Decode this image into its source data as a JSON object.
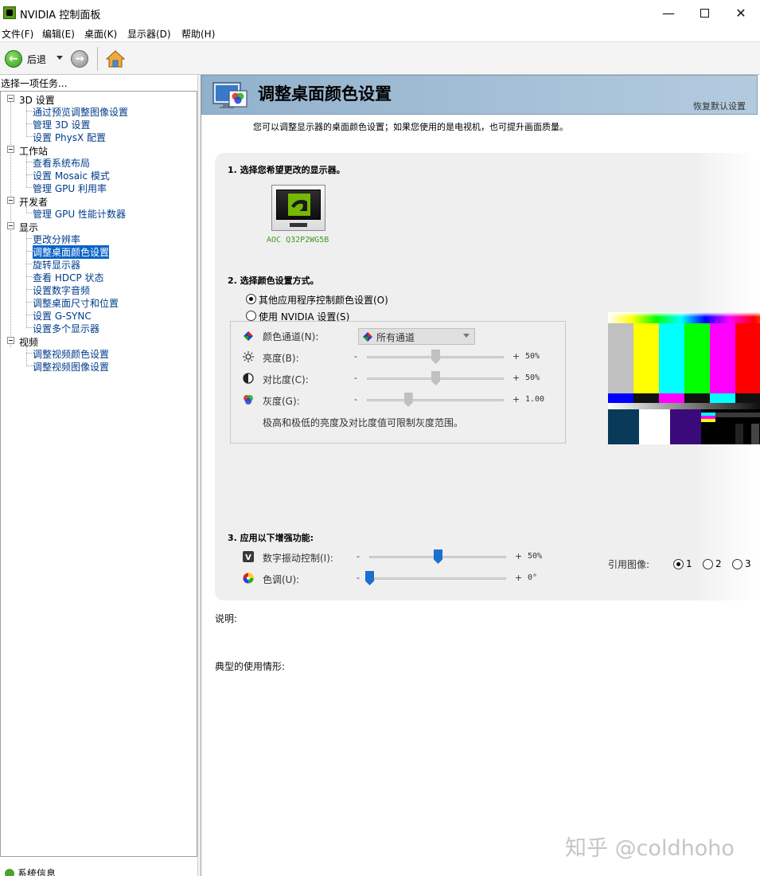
{
  "window": {
    "title": "NVIDIA 控制面板"
  },
  "menu": [
    "文件(F)",
    "编辑(E)",
    "桌面(K)",
    "显示器(D)",
    "帮助(H)"
  ],
  "toolbar": {
    "back_label": "后退"
  },
  "left": {
    "header": "选择一项任务...",
    "categories": [
      {
        "label": "3D 设置",
        "items": [
          "通过预览调整图像设置",
          "管理 3D 设置",
          "设置 PhysX 配置"
        ]
      },
      {
        "label": "工作站",
        "items": [
          "查看系统布局",
          "设置 Mosaic 模式",
          "管理 GPU 利用率"
        ]
      },
      {
        "label": "开发者",
        "items": [
          "管理 GPU 性能计数器"
        ]
      },
      {
        "label": "显示",
        "items": [
          "更改分辨率",
          "调整桌面颜色设置",
          "旋转显示器",
          "查看 HDCP 状态",
          "设置数字音频",
          "调整桌面尺寸和位置",
          "设置 G-SYNC",
          "设置多个显示器"
        ]
      },
      {
        "label": "视频",
        "items": [
          "调整视频颜色设置",
          "调整视频图像设置"
        ]
      }
    ],
    "selected": "调整桌面颜色设置",
    "system_info": "系统信息"
  },
  "page": {
    "title": "调整桌面颜色设置",
    "restore": "恢复默认设置",
    "intro": "您可以调整显示器的桌面颜色设置；如果您使用的是电视机，也可提升画面质量。",
    "section1": "1. 选择您希望更改的显示器。",
    "monitor_name": "AOC Q32P2WG5B",
    "section2": "2. 选择颜色设置方式。",
    "radio_other": "其他应用程序控制颜色设置(O)",
    "radio_nvidia": "使用 NVIDIA 设置(S)",
    "radio_other_selected": true,
    "channel_label": "颜色通道(N):",
    "channel_value": "所有通道",
    "brightness_label": "亮度(B):",
    "brightness_value": "50%",
    "brightness_level": 0.5,
    "contrast_label": "对比度(C):",
    "contrast_value": "50%",
    "contrast_level": 0.5,
    "gamma_label": "灰度(G):",
    "gamma_value": "1.00",
    "gamma_level": 0.3,
    "note": "极高和极低的亮度及对比度值可限制灰度范围。",
    "section3": "3. 应用以下增强功能:",
    "vibrance_label": "数字振动控制(I):",
    "vibrance_value": "50%",
    "vibrance_level": 0.5,
    "hue_label": "色调(U):",
    "hue_value": "0°",
    "hue_level": 0.0,
    "minus": "-",
    "plus": "+",
    "ref_label": "引用图像:",
    "ref_options": [
      "1",
      "2",
      "3"
    ],
    "ref_selected": "1",
    "desc_label": "说明:",
    "usage_label": "典型的使用情形:"
  },
  "watermark": "知乎 @coldhoho",
  "colors": {
    "accent": "#0a64c8",
    "banner": "#a5bfd6",
    "nvidia_green": "#76b900",
    "slider_blue": "#1a6fd0"
  }
}
